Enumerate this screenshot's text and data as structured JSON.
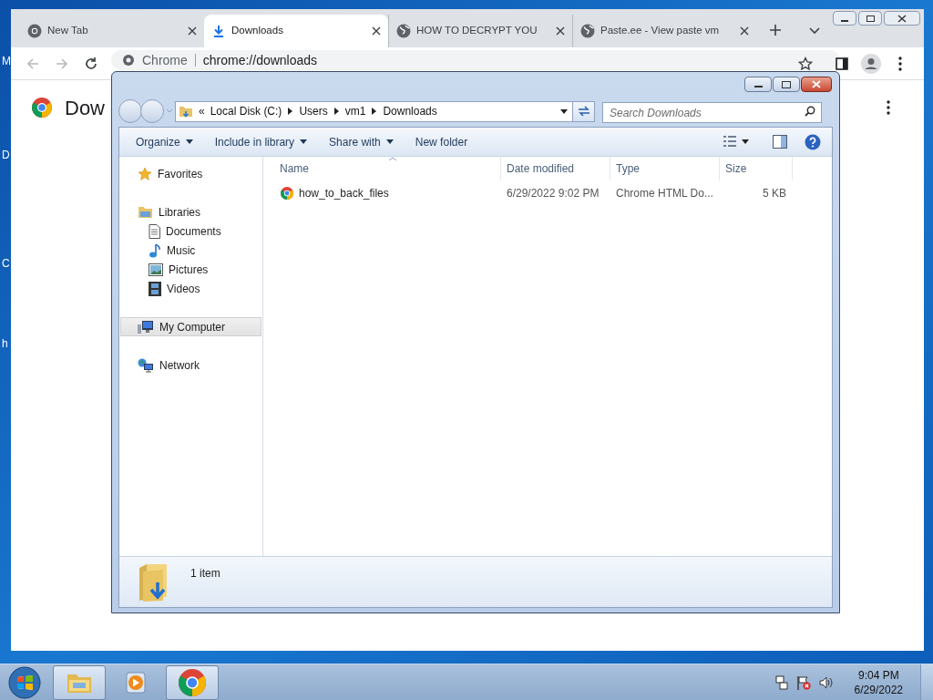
{
  "desktop_icons": [
    {
      "label": "M"
    },
    {
      "label": "D"
    },
    {
      "label": "C"
    },
    {
      "label": "h"
    }
  ],
  "browser": {
    "tabs": [
      {
        "title": "New Tab",
        "kind": "chrome",
        "selected": false
      },
      {
        "title": "Downloads",
        "kind": "download",
        "selected": true
      },
      {
        "title": "HOW TO DECRYPT YOU",
        "kind": "globe",
        "selected": false
      },
      {
        "title": "Paste.ee - View paste vm",
        "kind": "globe",
        "selected": false
      }
    ],
    "address": {
      "origin": "Chrome",
      "url": "chrome://downloads"
    },
    "page_title": "Dow"
  },
  "explorer": {
    "breadcrumb_overflow": "«",
    "breadcrumb": [
      "Local Disk (C:)",
      "Users",
      "vm1",
      "Downloads"
    ],
    "search": {
      "placeholder": "Search Downloads"
    },
    "toolbar": [
      {
        "label": "Organize",
        "dropdown": true
      },
      {
        "label": "Include in library",
        "dropdown": true
      },
      {
        "label": "Share with",
        "dropdown": true
      },
      {
        "label": "New folder",
        "dropdown": false
      }
    ],
    "nav": [
      {
        "label": "Favorites",
        "kind": "star",
        "selected": false
      },
      {
        "label": "Libraries",
        "kind": "library",
        "selected": false,
        "children": [
          {
            "label": "Documents",
            "kind": "document",
            "selected": false
          },
          {
            "label": "Music",
            "kind": "music",
            "selected": false
          },
          {
            "label": "Pictures",
            "kind": "pictures",
            "selected": false
          },
          {
            "label": "Videos",
            "kind": "videos",
            "selected": false
          }
        ]
      },
      {
        "label": "My Computer",
        "kind": "computer",
        "selected": true
      },
      {
        "label": "Network",
        "kind": "network",
        "selected": false
      }
    ],
    "columns": [
      "Name",
      "Date modified",
      "Type",
      "Size"
    ],
    "files": [
      {
        "name": "how_to_back_files",
        "date": "6/29/2022 9:02 PM",
        "type": "Chrome HTML Do...",
        "size": "5 KB"
      }
    ],
    "status": "1 item"
  },
  "taskbar": {
    "apps": [
      {
        "kind": "explorer",
        "running": true
      },
      {
        "kind": "media",
        "running": false
      },
      {
        "kind": "chrome",
        "running": true
      }
    ],
    "clock": {
      "time": "9:04 PM",
      "date": "6/29/2022"
    }
  }
}
